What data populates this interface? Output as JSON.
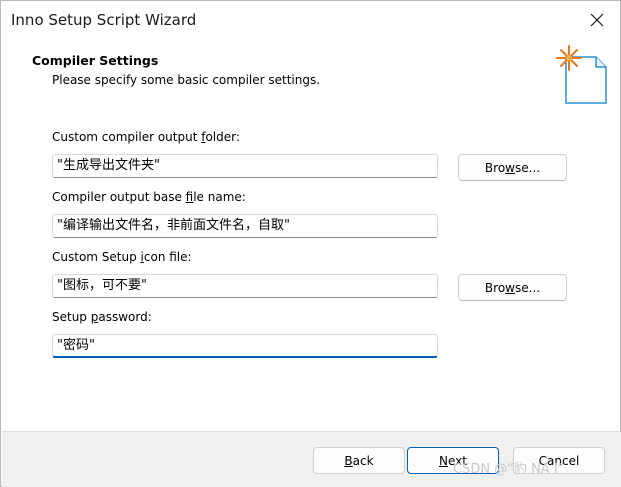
{
  "window": {
    "title": "Inno Setup Script Wizard"
  },
  "header": {
    "heading": "Compiler Settings",
    "subheading": "Please specify some basic compiler settings."
  },
  "fields": {
    "output_folder": {
      "label_pre": "Custom compiler output ",
      "label_ul": "f",
      "label_post": "older:",
      "value": "\"生成导出文件夹\""
    },
    "base_file_name": {
      "label_pre": "Compiler output base ",
      "label_ul": "f",
      "label_post": "ile name:",
      "value": "\"编译输出文件名，非前面文件名，自取\""
    },
    "icon_file": {
      "label_pre": "Custom Setup ",
      "label_ul": "i",
      "label_post": "con file:",
      "value": "\"图标，可不要\""
    },
    "password": {
      "label_pre": "Setup ",
      "label_ul": "p",
      "label_post": "assword:",
      "value": "\"密码\""
    }
  },
  "buttons": {
    "browse1_pre": "Bro",
    "browse1_ul": "w",
    "browse1_post": "se...",
    "browse2_pre": "Bro",
    "browse2_ul": "w",
    "browse2_post": "se...",
    "back_ul": "B",
    "back_post": "ack",
    "next_ul": "N",
    "next_post": "ext",
    "cancel": "Cancel"
  },
  "watermark": "CSDN @“豹 NA I”",
  "icons": {
    "close": "close-icon",
    "wizard": "wizard-document-icon"
  }
}
